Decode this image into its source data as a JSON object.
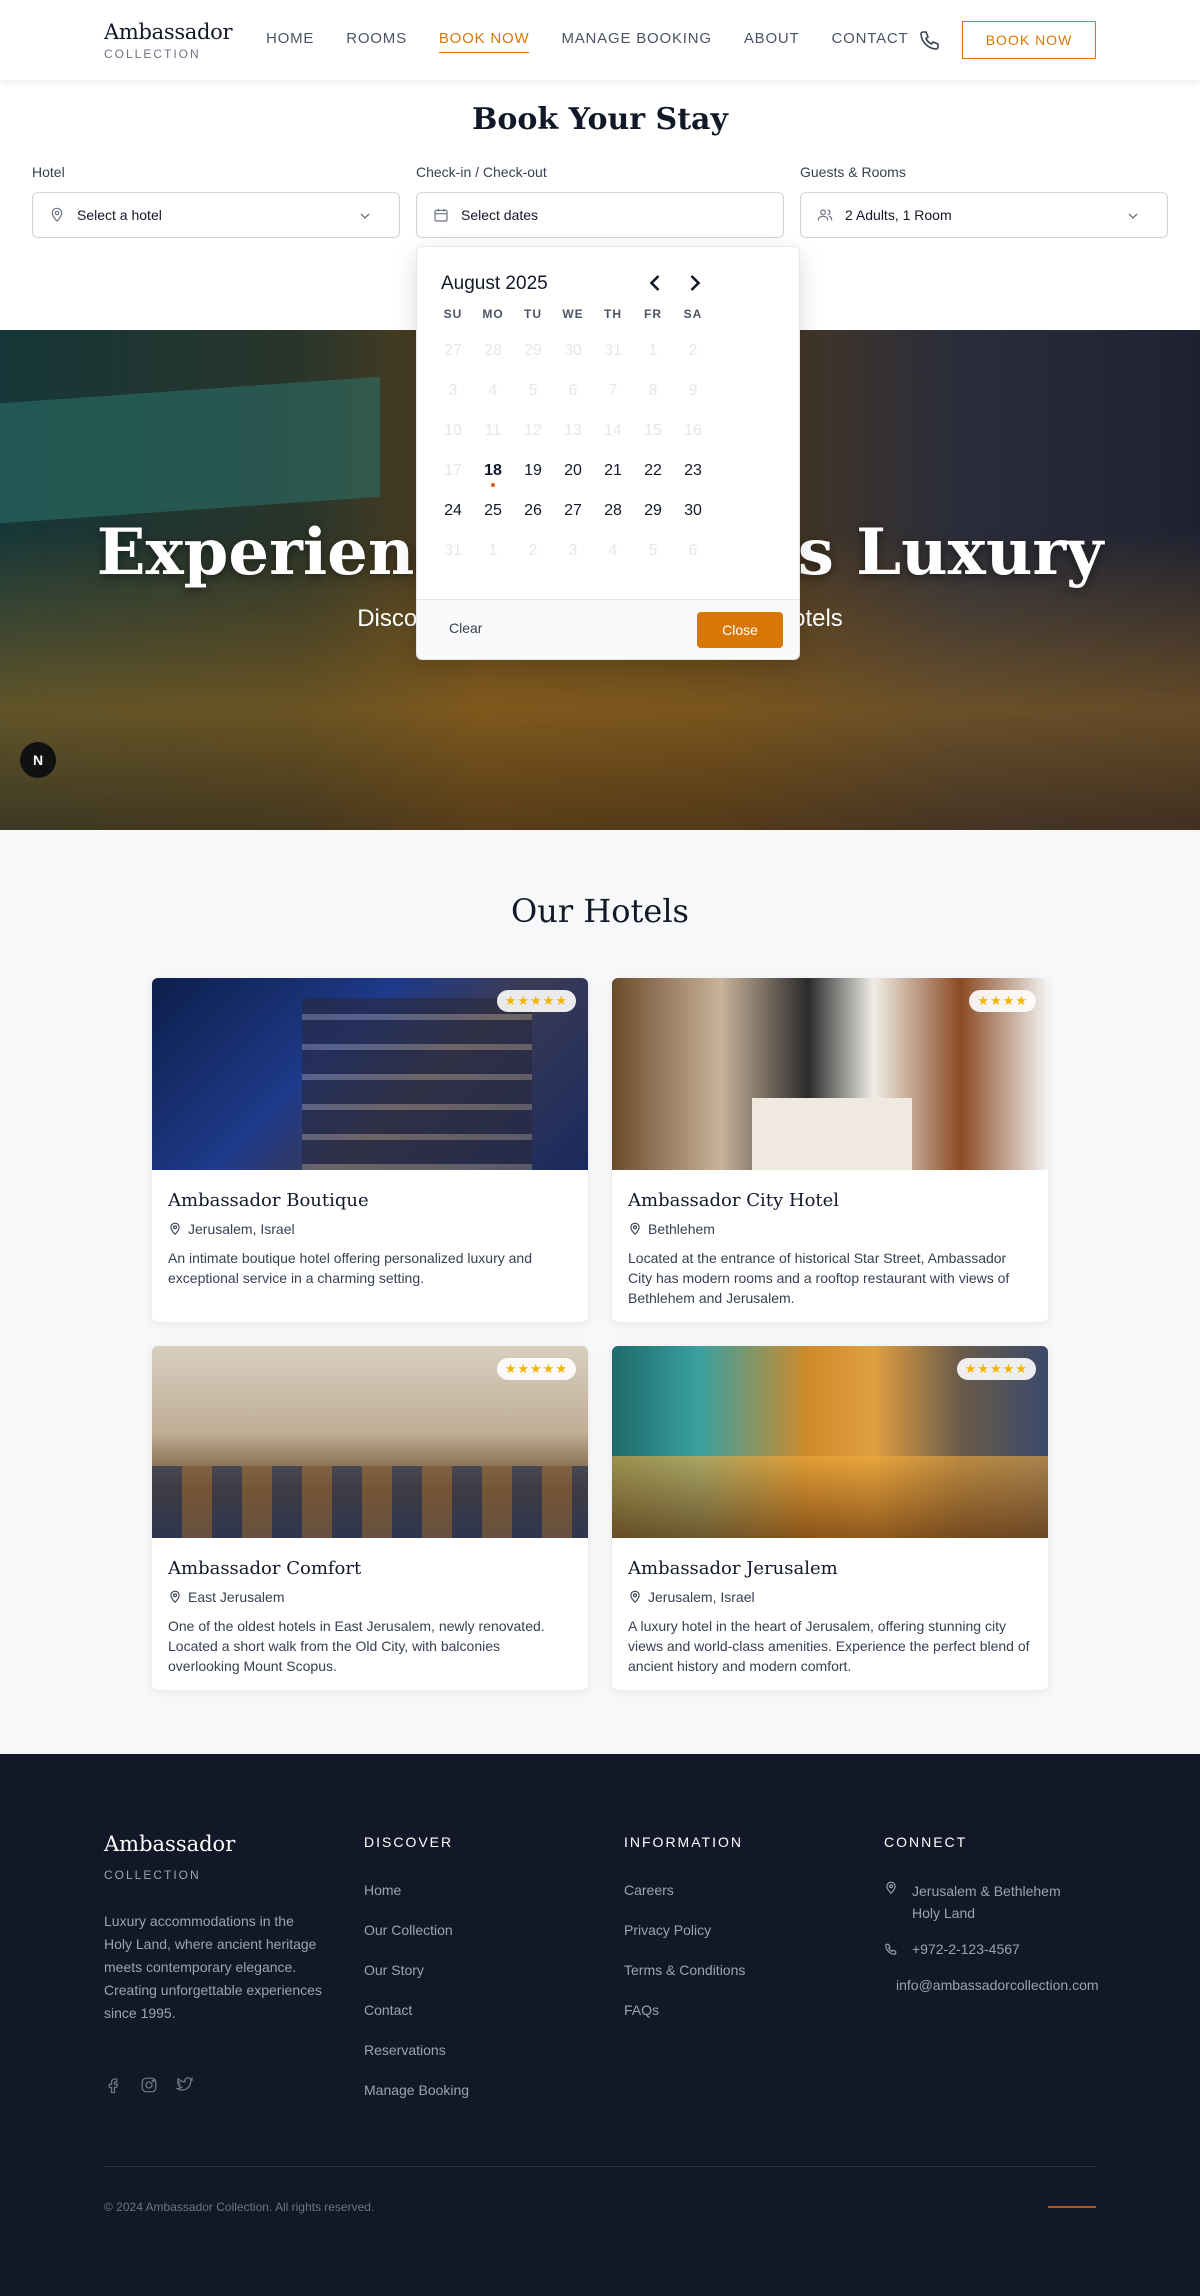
{
  "header": {
    "logo_main": "Ambassador",
    "logo_sub": "COLLECTION",
    "nav": [
      "HOME",
      "ROOMS",
      "BOOK NOW",
      "MANAGE BOOKING",
      "ABOUT",
      "CONTACT"
    ],
    "active_nav": "BOOK NOW",
    "book_button": "BOOK NOW",
    "phone_icon": "phone-icon"
  },
  "booking": {
    "title": "Book Your Stay",
    "hotel_label": "Hotel",
    "hotel_value": "Select a hotel",
    "dates_label": "Check-in / Check-out",
    "dates_value": "Select dates",
    "guests_label": "Guests & Rooms",
    "guests_value": "2 Adults, 1 Room"
  },
  "calendar": {
    "month": "August 2025",
    "weekdays": [
      "SU",
      "MO",
      "TU",
      "WE",
      "TH",
      "FR",
      "SA"
    ],
    "days": [
      [
        "27",
        "28",
        "29",
        "30",
        "31",
        "1",
        "2"
      ],
      [
        "3",
        "4",
        "5",
        "6",
        "7",
        "8",
        "9"
      ],
      [
        "10",
        "11",
        "12",
        "13",
        "14",
        "15",
        "16"
      ],
      [
        "17",
        "18",
        "19",
        "20",
        "21",
        "22",
        "23"
      ],
      [
        "24",
        "25",
        "26",
        "27",
        "28",
        "29",
        "30"
      ],
      [
        "31",
        "1",
        "2",
        "3",
        "4",
        "5",
        "6"
      ]
    ],
    "today": "18",
    "clear_label": "Clear",
    "close_label": "Close"
  },
  "hero": {
    "title": "Experience Timeless Luxury",
    "subtitle": "Discover our collection of distinguished hotels",
    "badge": "N"
  },
  "hotels": {
    "title": "Our Hotels",
    "items": [
      {
        "name": "Ambassador Boutique",
        "location": "Jerusalem, Israel",
        "stars": "★★★★★",
        "description": "An intimate boutique hotel offering personalized luxury and exceptional service in a charming setting."
      },
      {
        "name": "Ambassador City Hotel",
        "location": "Bethlehem",
        "stars": "★★★★",
        "description": "Located at the entrance of historical Star Street, Ambassador City has modern rooms and a rooftop restaurant with views of Bethlehem and Jerusalem."
      },
      {
        "name": "Ambassador Comfort",
        "location": "East Jerusalem",
        "stars": "★★★★★",
        "description": "One of the oldest hotels in East Jerusalem, newly renovated. Located a short walk from the Old City, with balconies overlooking Mount Scopus."
      },
      {
        "name": "Ambassador Jerusalem",
        "location": "Jerusalem, Israel",
        "stars": "★★★★★",
        "description": "A luxury hotel in the heart of Jerusalem, offering stunning city views and world-class amenities. Experience the perfect blend of ancient history and modern comfort."
      }
    ]
  },
  "footer": {
    "logo_main": "Ambassador",
    "logo_sub": "COLLECTION",
    "about": "Luxury accommodations in the Holy Land, where ancient heritage meets contemporary elegance. Creating unforgettable experiences since 1995.",
    "discover_title": "DISCOVER",
    "discover_links": [
      "Home",
      "Our Collection",
      "Our Story",
      "Contact",
      "Reservations",
      "Manage Booking"
    ],
    "info_title": "INFORMATION",
    "info_links": [
      "Careers",
      "Privacy Policy",
      "Terms & Conditions",
      "FAQs"
    ],
    "connect_title": "CONNECT",
    "address": "Jerusalem & Bethlehem Holy Land",
    "phone": "+972-2-123-4567",
    "email": "info@ambassadorcollection.com",
    "copyright": "© 2024 Ambassador Collection. All rights reserved."
  }
}
